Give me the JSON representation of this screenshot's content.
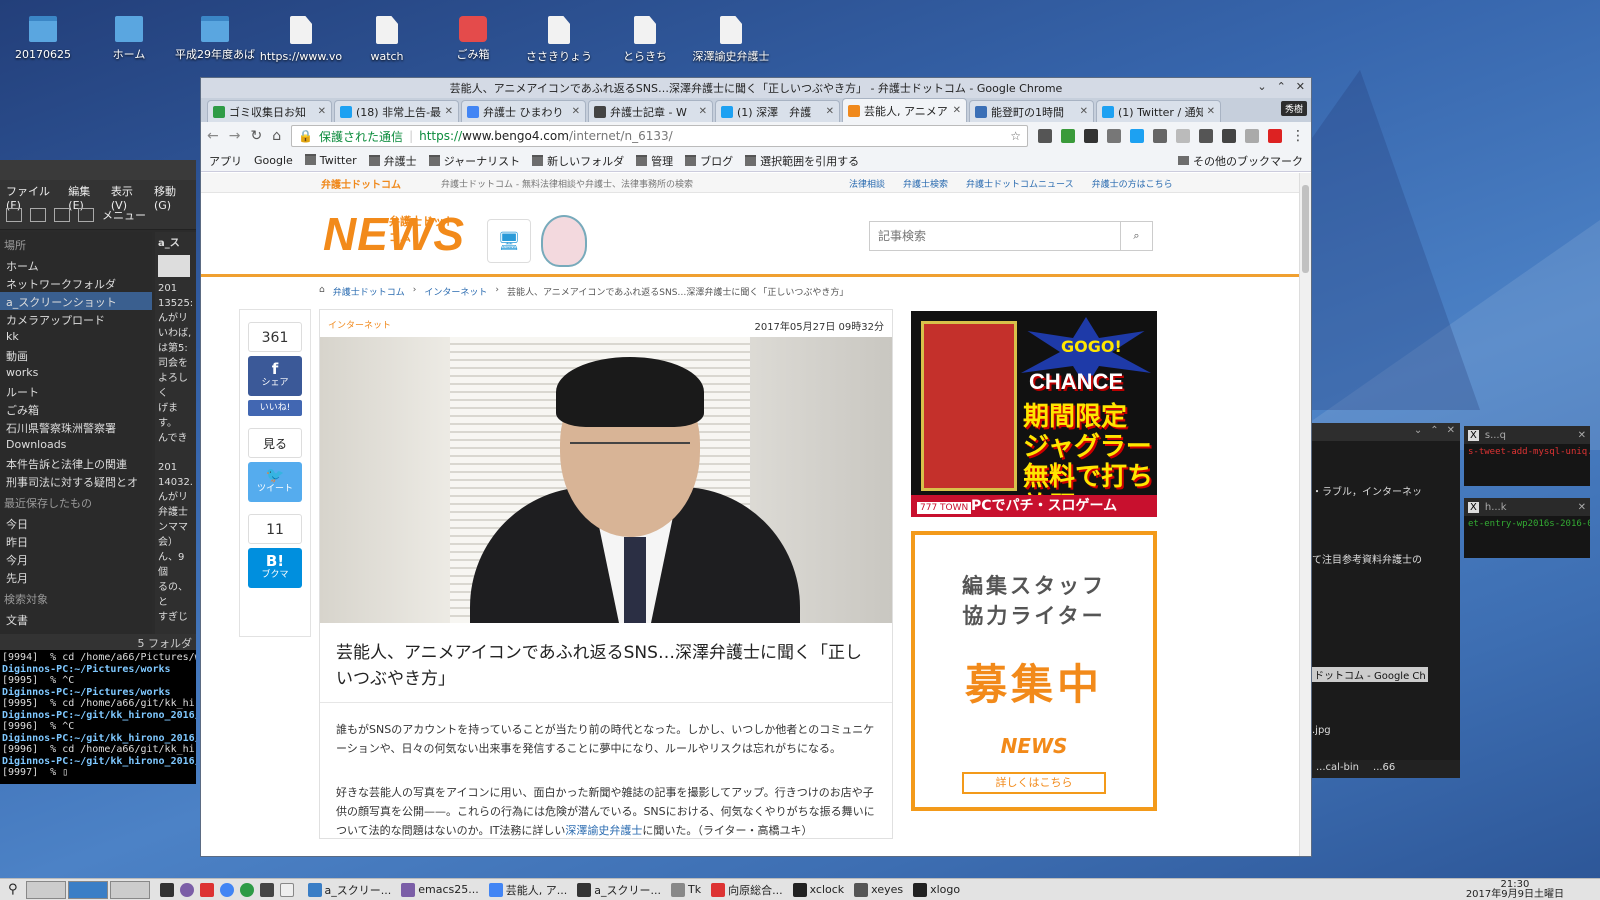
{
  "desktop": {
    "icons": [
      {
        "label": "20170625",
        "kind": "folder"
      },
      {
        "label": "ホーム",
        "kind": "home"
      },
      {
        "label": "平成29年度あば",
        "kind": "folder"
      },
      {
        "label": "https://www.vo",
        "kind": "file"
      },
      {
        "label": "watch",
        "kind": "file"
      },
      {
        "label": "ごみ箱",
        "kind": "trash"
      },
      {
        "label": "ささきりょう",
        "kind": "file"
      },
      {
        "label": "とらきち",
        "kind": "file"
      },
      {
        "label": "深澤諭史弁護士",
        "kind": "file"
      }
    ]
  },
  "file_manager": {
    "menu": [
      "ファイル(F)",
      "編集(E)",
      "表示(V)",
      "移動(G)"
    ],
    "toolbar_label": "メニュー",
    "places_heading": "場所",
    "places": [
      {
        "label": "ホーム"
      },
      {
        "label": "ネットワークフォルダ"
      },
      {
        "label": "a_スクリーンショット",
        "selected": true
      },
      {
        "label": "カメラアップロード"
      },
      {
        "label": "kk"
      },
      {
        "label": "動画"
      },
      {
        "label": "works"
      },
      {
        "label": "ルート"
      },
      {
        "label": "ごみ箱"
      },
      {
        "label": "石川県警察珠洲警察署"
      },
      {
        "label": "Downloads"
      },
      {
        "label": "本件告訴と法律上の関連"
      },
      {
        "label": "刑事司法に対する疑問とオ"
      }
    ],
    "recent_heading": "最近保存したもの",
    "recent": [
      "今日",
      "昨日",
      "今月",
      "先月"
    ],
    "search_heading": "検索対象",
    "search_items": [
      "文書"
    ],
    "column_header": "a_ス",
    "content_lines": [
      "201",
      "13525:",
      "んがリ",
      "いわば,",
      "は第5:",
      "司会を",
      "よろしく",
      "げます。",
      "んでき",
      "201",
      "14032.",
      "んがリ",
      "弁護士",
      "ンママ",
      "会）",
      "ん、9個",
      "るの、と",
      "すぎじ"
    ],
    "status": "5 フォルダ"
  },
  "terminal": {
    "lines": [
      {
        "type": "out",
        "text": "[9994]  % cd /home/a66/Pictures/w"
      },
      {
        "type": "prompt",
        "text": "Diginnos-PC:~/Pictures/works"
      },
      {
        "type": "out",
        "text": "[9995]  % ^C"
      },
      {
        "type": "prompt",
        "text": "Diginnos-PC:~/Pictures/works"
      },
      {
        "type": "out",
        "text": "[9995]  % cd /home/a66/git/kk_hir"
      },
      {
        "type": "prompt",
        "text": "Diginnos-PC:~/git/kk_hirono_2016/a"
      },
      {
        "type": "out",
        "text": "[9996]  % ^C"
      },
      {
        "type": "prompt",
        "text": "Diginnos-PC:~/git/kk_hirono_2016/a"
      },
      {
        "type": "out",
        "text": "[9996]  % cd /home/a66/git/kk_hir"
      },
      {
        "type": "prompt",
        "text": "Diginnos-PC:~/git/kk_hirono_2016/a"
      },
      {
        "type": "out",
        "text": "[9997]  % ▯"
      }
    ]
  },
  "right_terminal": {
    "lines": [
      "・ラブル，インターネッ",
      "て注目参考資料弁護士の",
      "ドットコム - Google Ch",
      ".jpg"
    ],
    "tabs": [
      "...cal-bin",
      "...66"
    ]
  },
  "mini_windows": [
    {
      "title": "s...q",
      "body": "s-tweet-add-mysql-uniq.lis"
    },
    {
      "title": "h...k",
      "body": "et-entry-wp2016s-2016-0"
    }
  ],
  "browser": {
    "window_title": "芸能人、アニメアイコンであふれ返るSNS…深澤弁護士に聞く「正しいつぶやき方」 - 弁護士ドットコム - Google Chrome",
    "tabs": [
      {
        "label": "ゴミ収集日お知",
        "color": "#2e9b46"
      },
      {
        "label": "(18) 非常上告-最",
        "color": "#1da1f2"
      },
      {
        "label": "弁護士 ひまわり",
        "color": "#4285f4"
      },
      {
        "label": "弁護士記章 - W",
        "color": "#444444"
      },
      {
        "label": "(1) 深澤　弁護",
        "color": "#1da1f2"
      },
      {
        "label": "芸能人, アニメア",
        "color": "#f0891c",
        "active": true
      },
      {
        "label": "能登町の1時間",
        "color": "#3b6fb6"
      },
      {
        "label": "(1) Twitter / 通知",
        "color": "#1da1f2"
      }
    ],
    "profile": "秀樹",
    "secure_label": "保護された通信",
    "url_scheme": "https://",
    "url_host": "www.bengo4.com",
    "url_path": "/internet/n_6133/",
    "bookmarks": [
      "アプリ",
      "Google",
      "Twitter",
      "弁護士",
      "ジャーナリスト",
      "新しいフォルダ",
      "管理",
      "ブログ",
      "選択範囲を引用する"
    ],
    "other_bookmarks": "その他のブックマーク"
  },
  "site": {
    "topbar_logo": "弁護士ドットコム",
    "topbar_desc": "弁護士ドットコム - 無料法律相談や弁護士、法律事務所の検索",
    "topbar_links": [
      "法律相談",
      "弁護士検索",
      "弁護士ドットコムニュース",
      "弁護士の方はこちら"
    ],
    "brand": "NEWS",
    "brand_sub": "弁護士ドットコム",
    "search_placeholder": "記事検索",
    "breadcrumb": [
      "弁護士ドットコム",
      "インターネット",
      "芸能人、アニメアイコンであふれ返るSNS…深澤弁護士に聞く「正しいつぶやき方」"
    ],
    "share": {
      "fb_count": "361",
      "fb_label": "シェア",
      "like_label": "いいね!",
      "look_label": "見る",
      "tweet_label": "ツイート",
      "hatena_count": "11",
      "hatena_label": "ブクマ"
    },
    "article": {
      "category": "インターネット",
      "date": "2017年05月27日 09時32分",
      "title": "芸能人、アニメアイコンであふれ返るSNS…深澤弁護士に聞く「正しいつぶやき方」",
      "p1": "誰もがSNSのアカウントを持っていることが当たり前の時代となった。しかし、いつしか他者とのコミュニケーションや、日々の何気ない出来事を発信することに夢中になり、ルールやリスクは忘れがちになる。",
      "p2_before": "好きな芸能人の写真をアイコンに用い、面白かった新聞や雑誌の記事を撮影してアップ。行きつけのお店や子供の顔写真を公開——。これらの行為には危険が潜んでいる。SNSにおける、何気なくやりがちな振る舞いについて法的な問題はないのか。IT法務に詳しい",
      "p2_link": "深澤諭史弁護士",
      "p2_after": "に聞いた。（ライター・高橋ユキ）"
    },
    "ad1": {
      "gogo": "GOGO!",
      "chance": "CHANCE",
      "promo": "期間限定ジャグラー無料で打ち放題!",
      "footer": "PCでパチ・スロゲーム",
      "brand": "777 TOWN"
    },
    "ad2": {
      "line1": "編集スタッフ",
      "line2": "協力ライター",
      "big": "募集中",
      "logo": "NEWS",
      "button": "詳しくはこちら"
    }
  },
  "taskbar": {
    "items": [
      "a_スクリー...",
      "emacs25...",
      "芸能人, ア...",
      "a_スクリー...",
      "Tk",
      "向原総合...",
      "xclock",
      "xeyes",
      "xlogo"
    ],
    "time": "21:30",
    "date": "2017年9月9日土曜日"
  }
}
